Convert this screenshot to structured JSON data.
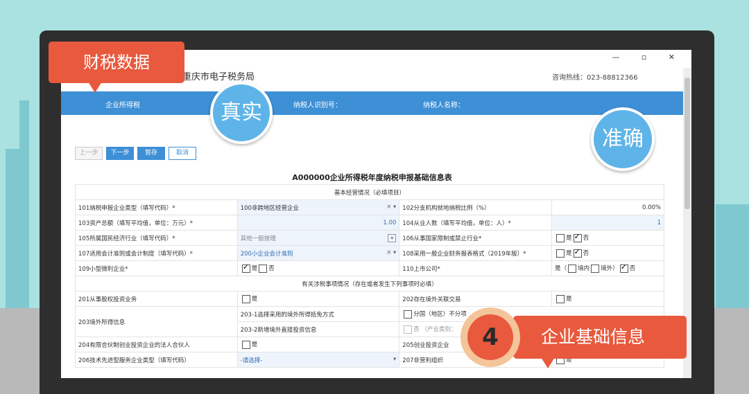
{
  "window": {
    "brand": "重庆市电子税务局",
    "hotline": "咨询热线：023-88812366",
    "controls": "— ▫ ✕"
  },
  "bluebar": {
    "tax_type": "企业所得税",
    "taxpayer_id": "纳税人识别号：",
    "taxpayer_name": "纳税人名称："
  },
  "toolbar": {
    "prev": "上一步",
    "next": "下一步",
    "save": "暂存",
    "cancel": "取消"
  },
  "form": {
    "title": "A000000企业所得税年度纳税申报基础信息表",
    "section1": "基本经营情况（必填项目）",
    "section2": "有关涉税事项情况（存在或者发生下列事项时必填）",
    "rows": {
      "r101_label": "101纳税申报企业类型（填写代码）*",
      "r101_value": "100非跨地区经营企业",
      "r102_label": "102分支机构就地纳税比例（%）",
      "r102_value": "0.00%",
      "r103_label": "103资产总额（填写平均值，单位：万元）*",
      "r103_value": "1.00",
      "r104_label": "104从业人数（填写平均值，单位：人）*",
      "r104_value": "1",
      "r105_label": "105所属国民经济行业（填写代码）*",
      "r105_value": "其他一般按理",
      "r106_label": "106从事国家限制或禁止行业*",
      "r107_label": "107适用会计准则或会计制度（填写代码）*",
      "r107_value": "200小企业会计准则",
      "r108_label": "108采用一般企业财务报表格式（2019年版）*",
      "r109_label": "109小型微利企业*",
      "r110_label": "110上市公司*",
      "r201_label": "201从事股权投资业务",
      "r202_label": "202存在境外关联交易",
      "r203_label": "203境外所得信息",
      "r203_1_label": "203-1选择采用的境外所得抵免方式",
      "r203_1_value": "分国（地区）不分项",
      "r203_2_label": "203-2新增境外直接投资信息",
      "r203_2_value": "否 （产业类别：",
      "r204_label": "204有限合伙制创业投资企业的法人合伙人",
      "r205_label": "205创业投资企业",
      "r206_label": "206技术先进型服务企业类型（填写代码）",
      "r206_value": "-请选择-",
      "r207_label": "207非营利组织"
    },
    "opt_yes": "是",
    "opt_no": "否",
    "opt_listed_yes": "是（",
    "opt_domestic": "境内",
    "opt_overseas": "境外）"
  },
  "overlay": {
    "callout_top": "财税数据",
    "badge_real": "真实",
    "badge_accurate": "准确",
    "step_number": "4",
    "callout_bottom": "企业基础信息"
  },
  "colors": {
    "accent_blue": "#3d8fd6",
    "callout_orange": "#e8593d",
    "badge_blue": "#5eb4e8",
    "background_teal": "#a9e2e0"
  }
}
